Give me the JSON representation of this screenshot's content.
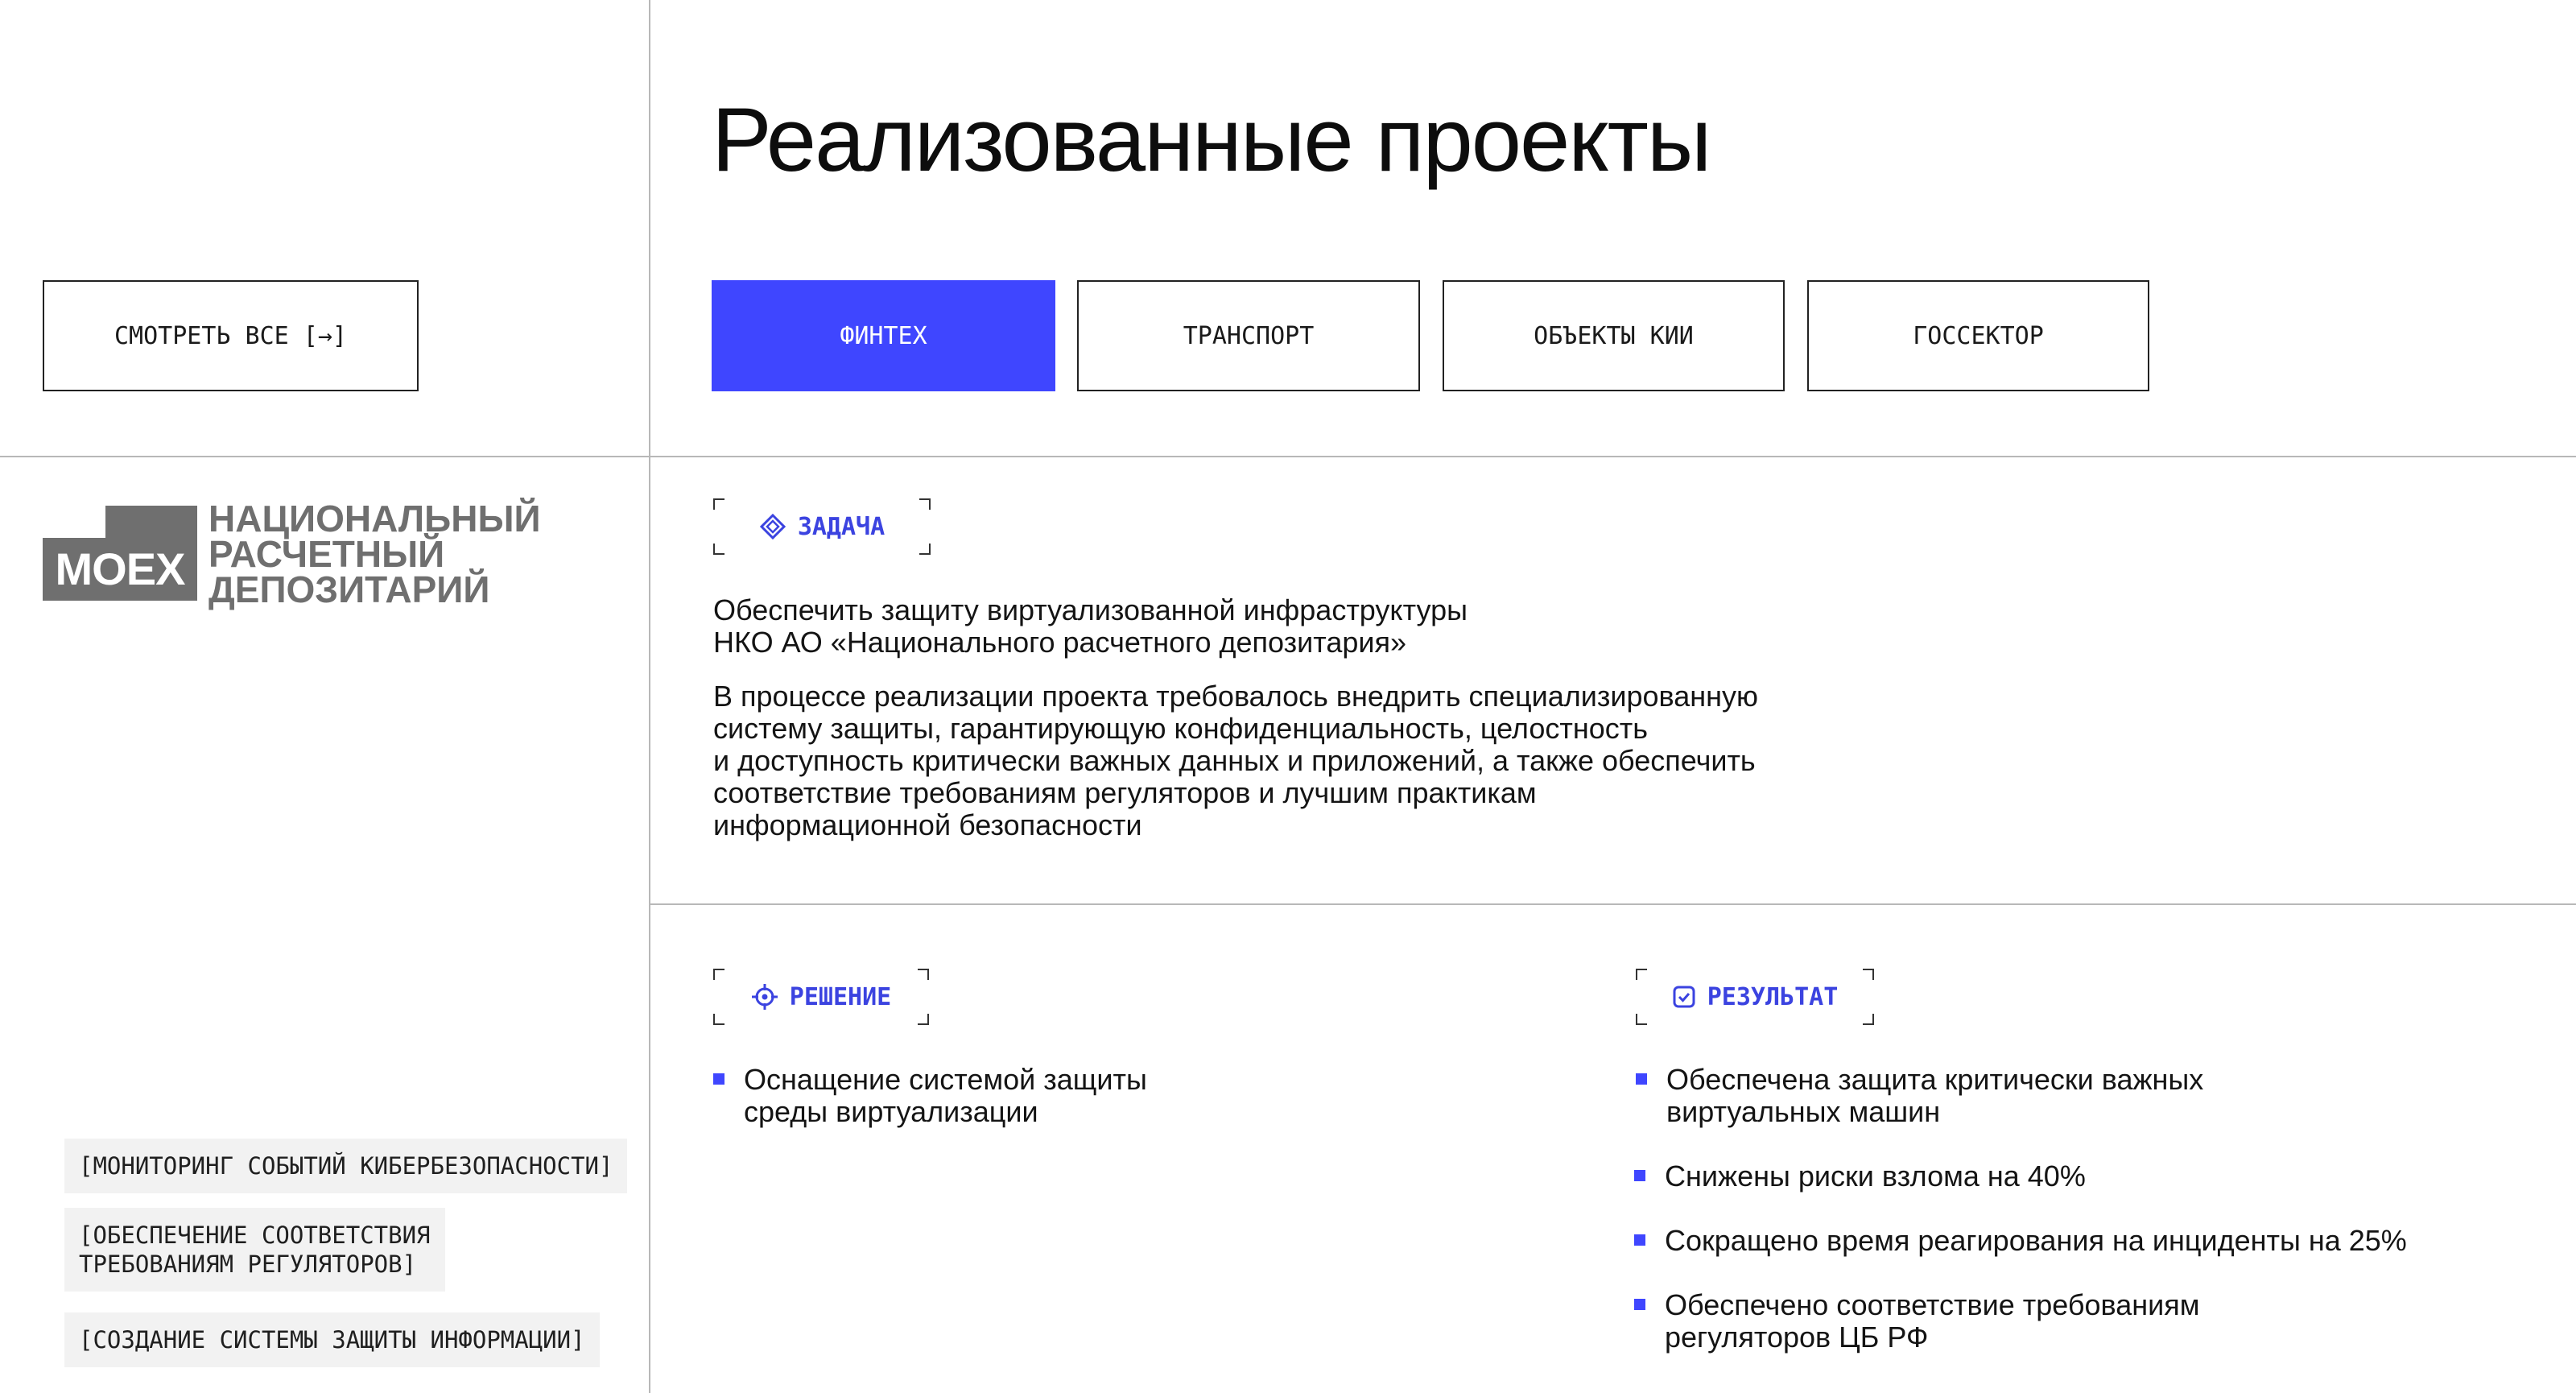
{
  "header": {
    "title": "Реализованные проекты"
  },
  "view_all": {
    "label": "СМОТРЕТЬ ВСЕ [→]"
  },
  "tabs": [
    {
      "label": "ФИНТЕХ",
      "active": true
    },
    {
      "label": "ТРАНСПОРТ",
      "active": false
    },
    {
      "label": "ОБЪЕКТЫ КИИ",
      "active": false
    },
    {
      "label": "ГОССЕКТОР",
      "active": false
    }
  ],
  "logo": {
    "mark": "MOEX",
    "lines": [
      "НАЦИОНАЛЬНЫЙ",
      "РАСЧЕТНЫЙ",
      "ДЕПОЗИТАРИЙ"
    ]
  },
  "task": {
    "label": "ЗАДАЧА",
    "lead": [
      "Обеспечить защиту виртуализованной инфраструктуры",
      "НКО АО «Национального расчетного депозитария»"
    ],
    "body": [
      "В процессе реализации проекта требовалось внедрить специализированную",
      "систему защиты, гарантирующую конфиденциальность, целостность",
      "и доступность критически важных данных и приложений, а также обеспечить",
      "соответствие требованиям регуляторов и лучшим практикам",
      "информационной безопасности"
    ]
  },
  "solution": {
    "label": "РЕШЕНИЕ",
    "items": [
      [
        "Оснащение системой защиты",
        "среды виртуализации"
      ]
    ]
  },
  "result": {
    "label": "РЕЗУЛЬТАТ",
    "items": [
      [
        "Обеспечена защита критически важных",
        "виртуальных машин"
      ],
      [
        "Снижены риски взлома на 40%"
      ],
      [
        "Сокращено время реагирования на инциденты на 25%"
      ],
      [
        "Обеспечено соответствие требованиям",
        "регуляторов ЦБ РФ"
      ]
    ]
  },
  "tags": [
    [
      "[МОНИТОРИНГ СОБЫТИЙ КИБЕРБЕЗОПАСНОСТИ]"
    ],
    [
      "[ОБЕСПЕЧЕНИЕ СООТВЕТСТВИЯ",
      "ТРЕБОВАНИЯМ РЕГУЛЯТОРОВ]"
    ],
    [
      "[СОЗДАНИЕ СИСТЕМЫ ЗАЩИТЫ ИНФОРМАЦИИ]"
    ]
  ],
  "colors": {
    "accent": "#3f46ff",
    "accent_text": "#3b43e0",
    "logo_gray": "#6f6f6f",
    "divider": "#b8b8b8"
  }
}
